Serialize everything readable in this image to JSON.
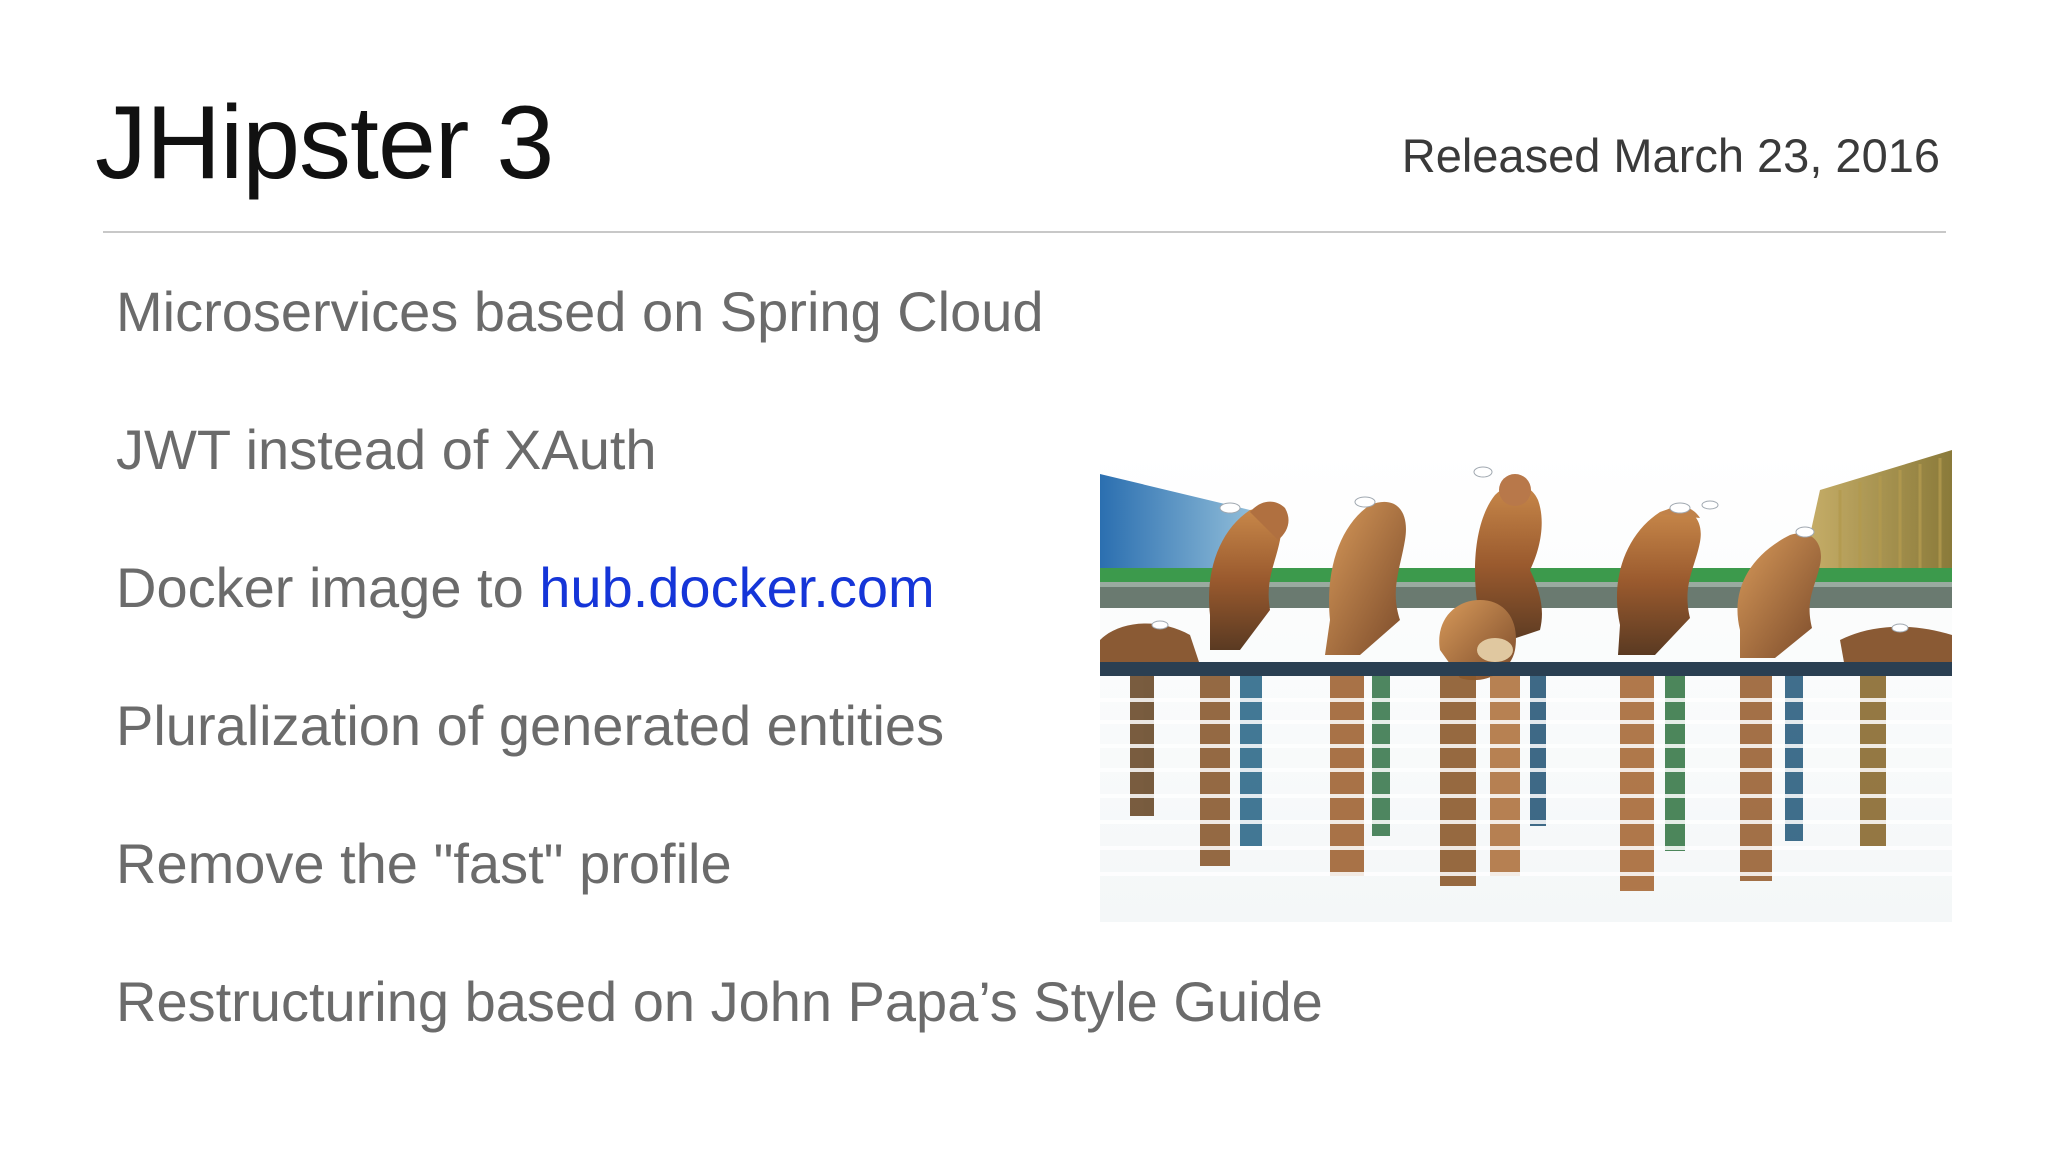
{
  "slide": {
    "title": "JHipster 3",
    "release_date": "Released March 23, 2016",
    "bullets": [
      {
        "text": "Microservices based on Spring Cloud"
      },
      {
        "text": "JWT instead of XAuth"
      },
      {
        "text": "Docker image to ",
        "link": "hub.docker.com"
      },
      {
        "text": "Pluralization of generated entities"
      },
      {
        "text": "Remove the \"fast\" profile"
      },
      {
        "text": "Restructuring based on John Papa’s Style Guide"
      }
    ]
  },
  "image": {
    "icon": "fountain-sculpture-photo"
  },
  "colors": {
    "title": "#111111",
    "bullet_text": "#6b6b6b",
    "link": "#1535d8",
    "divider": "#c8c8c8"
  }
}
